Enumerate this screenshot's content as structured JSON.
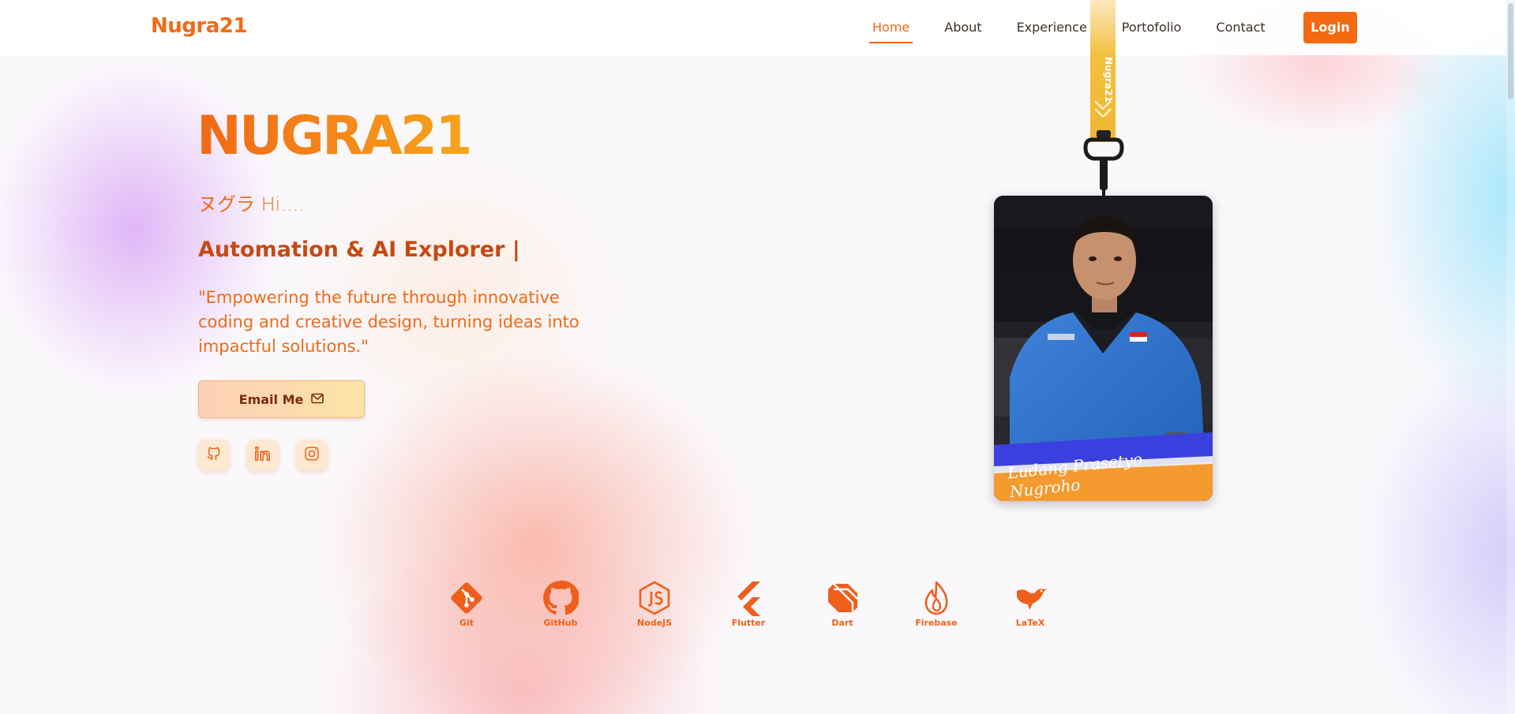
{
  "nav": {
    "brand": "Nugra21",
    "links": [
      {
        "label": "Home",
        "active": true
      },
      {
        "label": "About",
        "active": false
      },
      {
        "label": "Experience",
        "active": false
      },
      {
        "label": "Portofolio",
        "active": false
      },
      {
        "label": "Contact",
        "active": false
      }
    ],
    "login_label": "Login"
  },
  "hero": {
    "title": "NUGRA21",
    "greeting": "ヌグラ Hi....",
    "role": "Automation & AI Explorer |",
    "quote": "\"Empowering the future through innovative coding and creative design, turning ideas into impactful solutions.\"",
    "email_button": "Email Me",
    "socials": [
      {
        "icon": "github-icon"
      },
      {
        "icon": "linkedin-icon"
      },
      {
        "icon": "instagram-icon"
      }
    ]
  },
  "id_card": {
    "lanyard_text": "Nugra21",
    "signature": "Ludang Prasetyo Nugroho"
  },
  "tech_stack": [
    {
      "name": "Git",
      "icon": "git-icon"
    },
    {
      "name": "GitHub",
      "icon": "github-icon"
    },
    {
      "name": "NodeJS",
      "icon": "nodejs-icon"
    },
    {
      "name": "Flutter",
      "icon": "flutter-icon"
    },
    {
      "name": "Dart",
      "icon": "dart-icon"
    },
    {
      "name": "Firebase",
      "icon": "firebase-icon"
    },
    {
      "name": "LaTeX",
      "icon": "latex-icon"
    }
  ],
  "colors": {
    "accent": "#f06a16",
    "accent_dark": "#c94811",
    "button_gradient_start": "#fbd0b8",
    "button_gradient_end": "#fde4a6"
  }
}
